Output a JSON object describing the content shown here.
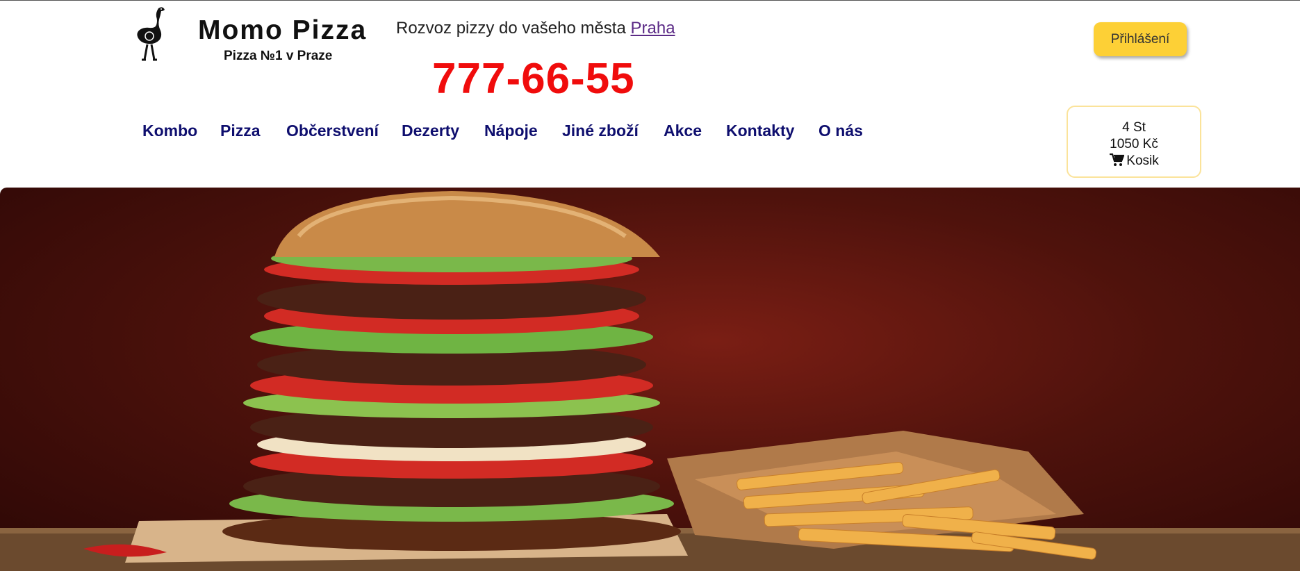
{
  "brand": {
    "title": "Momo Pizza",
    "subtitle": "Pizza №1 v Praze",
    "logo_icon": "ostrich-icon"
  },
  "header": {
    "delivery_text": "Rozvoz pizzy do vašeho města",
    "city_link": "Praha",
    "phone": "777-66-55",
    "login_label": "Přihlášení"
  },
  "nav": {
    "items": [
      {
        "label": "Kombo"
      },
      {
        "label": "Pizza"
      },
      {
        "label": "Občerstvení"
      },
      {
        "label": "Dezerty"
      },
      {
        "label": "Nápoje"
      },
      {
        "label": "Jiné zboží"
      },
      {
        "label": "Akce"
      },
      {
        "label": "Kontakty"
      },
      {
        "label": "O nás"
      }
    ]
  },
  "cart": {
    "count": "4 St",
    "total": "1050 Kč",
    "label": "Kosik",
    "icon": "shopping-cart-icon"
  },
  "hero": {
    "image": "burger-and-fries-photo"
  },
  "colors": {
    "phone": "#f00c0c",
    "nav": "#0e0e6e",
    "login_button": "#fdd036",
    "cart_border": "#fbe39a"
  }
}
